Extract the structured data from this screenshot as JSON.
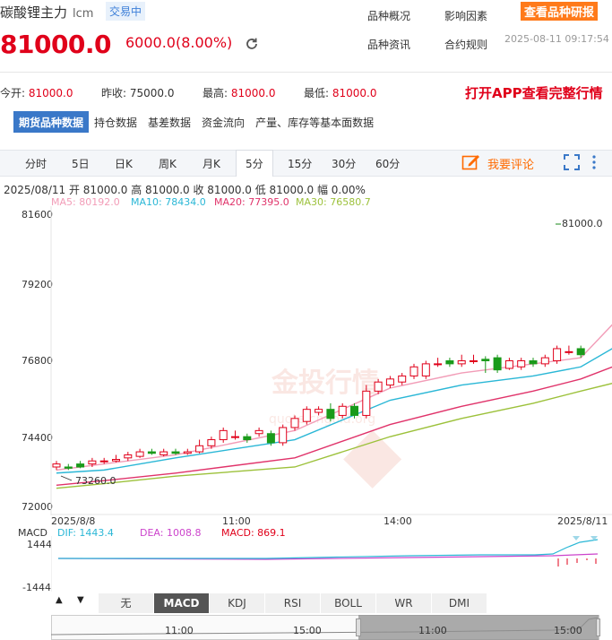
{
  "header": {
    "name": "碳酸锂主力",
    "code": "lcm",
    "status": "交易中",
    "links": [
      "品种概况",
      "影响因素",
      "品种资讯",
      "合约规则"
    ],
    "research_btn": "查看品种研报",
    "price": "81000.0",
    "change": "6000.0(8.00%)",
    "timestamp": "2025-08-11 09:17:54"
  },
  "stats": {
    "open_label": "今开:",
    "open": "81000.0",
    "prev_label": "昨收:",
    "prev": "75000.0",
    "high_label": "最高:",
    "high": "81000.0",
    "low_label": "最低:",
    "low": "81000.0",
    "app_promo": "打开APP查看完整行情"
  },
  "tabs": [
    "期货品种数据",
    "持仓数据",
    "基差数据",
    "资金流向",
    "产量、库存等基本面数据"
  ],
  "periods": [
    "分时",
    "5日",
    "日K",
    "周K",
    "月K",
    "5分",
    "15分",
    "30分",
    "60分"
  ],
  "active_period": "5分",
  "comment_label": "我要评论",
  "ohlc": "2025/08/11  开 81000.0  高 81000.0  收 81000.0  低 81000.0  幅 0.00%",
  "ma": {
    "ma5": "MA5: 80192.0",
    "ma10": "MA10: 78434.0",
    "ma20": "MA20: 77395.0",
    "ma30": "MA30: 76580.7",
    "colors": {
      "ma5": "#f29cb7",
      "ma10": "#2ab7d6",
      "ma20": "#e0336a",
      "ma30": "#9cc13a"
    }
  },
  "y_ticks": [
    "81600",
    "79200",
    "76800",
    "74400",
    "72000"
  ],
  "x_ticks": [
    "2025/8/8",
    "11:00",
    "14:00",
    "2025/8/11"
  ],
  "last_price_label": "81000.0",
  "low_marker": "73260.0",
  "watermark": "金投行情",
  "watermark_url": "quote.cngold.org",
  "macd": {
    "label": "MACD",
    "dif": "DIF: 1443.4",
    "dea": "DEA: 1008.8",
    "macd": "MACD: 869.1",
    "top": "1444",
    "bottom": "-1444",
    "colors": {
      "dif": "#2ab7d6",
      "dea": "#cc44cc",
      "macd": "#e0001a"
    }
  },
  "indicators": [
    "无",
    "MACD",
    "KDJ",
    "RSI",
    "BOLL",
    "WR",
    "DMI"
  ],
  "active_indicator": "MACD",
  "navigator": [
    "11:00",
    "15:00",
    "11:00",
    "15:00"
  ],
  "chart_data": {
    "type": "candlestick",
    "y_range": [
      72000,
      81600
    ],
    "candles": [
      {
        "o": 73300,
        "c": 73400,
        "h": 73500,
        "l": 73200
      },
      {
        "o": 73300,
        "c": 73260,
        "h": 73400,
        "l": 73200
      },
      {
        "o": 73400,
        "c": 73300,
        "h": 73500,
        "l": 73260
      },
      {
        "o": 73400,
        "c": 73500,
        "h": 73600,
        "l": 73300
      },
      {
        "o": 73500,
        "c": 73500,
        "h": 73600,
        "l": 73400
      },
      {
        "o": 73500,
        "c": 73550,
        "h": 73700,
        "l": 73450
      },
      {
        "o": 73600,
        "c": 73700,
        "h": 73800,
        "l": 73500
      },
      {
        "o": 73650,
        "c": 73800,
        "h": 73900,
        "l": 73600
      },
      {
        "o": 73800,
        "c": 73750,
        "h": 73900,
        "l": 73700
      },
      {
        "o": 73700,
        "c": 73800,
        "h": 73900,
        "l": 73650
      },
      {
        "o": 73800,
        "c": 73750,
        "h": 73900,
        "l": 73700
      },
      {
        "o": 73750,
        "c": 73800,
        "h": 73900,
        "l": 73700
      },
      {
        "o": 73800,
        "c": 74000,
        "h": 74200,
        "l": 73750
      },
      {
        "o": 74000,
        "c": 74200,
        "h": 74300,
        "l": 73900
      },
      {
        "o": 74200,
        "c": 74500,
        "h": 74600,
        "l": 74100
      },
      {
        "o": 74300,
        "c": 74300,
        "h": 74500,
        "l": 74200
      },
      {
        "o": 74300,
        "c": 74200,
        "h": 74400,
        "l": 74100
      },
      {
        "o": 74400,
        "c": 74500,
        "h": 74600,
        "l": 74300
      },
      {
        "o": 74400,
        "c": 74100,
        "h": 74500,
        "l": 74000
      },
      {
        "o": 74100,
        "c": 74600,
        "h": 74700,
        "l": 74000
      },
      {
        "o": 74600,
        "c": 74900,
        "h": 75000,
        "l": 74500
      },
      {
        "o": 74800,
        "c": 75200,
        "h": 75300,
        "l": 74700
      },
      {
        "o": 75100,
        "c": 75200,
        "h": 75300,
        "l": 75000
      },
      {
        "o": 75200,
        "c": 74900,
        "h": 75400,
        "l": 74800
      },
      {
        "o": 75000,
        "c": 75300,
        "h": 75400,
        "l": 74900
      },
      {
        "o": 75300,
        "c": 75000,
        "h": 75400,
        "l": 74900
      },
      {
        "o": 75000,
        "c": 75800,
        "h": 76000,
        "l": 74900
      },
      {
        "o": 75800,
        "c": 76100,
        "h": 76200,
        "l": 75700
      },
      {
        "o": 76000,
        "c": 76200,
        "h": 76300,
        "l": 75900
      },
      {
        "o": 76100,
        "c": 76300,
        "h": 76400,
        "l": 76000
      },
      {
        "o": 76300,
        "c": 76600,
        "h": 76700,
        "l": 76200
      },
      {
        "o": 76300,
        "c": 76700,
        "h": 76800,
        "l": 76200
      },
      {
        "o": 76700,
        "c": 76700,
        "h": 76900,
        "l": 76600
      },
      {
        "o": 76800,
        "c": 76700,
        "h": 76900,
        "l": 76600
      },
      {
        "o": 76700,
        "c": 76800,
        "h": 77000,
        "l": 76600
      },
      {
        "o": 76800,
        "c": 76800,
        "h": 77000,
        "l": 76700
      },
      {
        "o": 76850,
        "c": 76800,
        "h": 76950,
        "l": 76400
      },
      {
        "o": 76900,
        "c": 76500,
        "h": 77000,
        "l": 76400
      },
      {
        "o": 76550,
        "c": 76800,
        "h": 76900,
        "l": 76500
      },
      {
        "o": 76600,
        "c": 76800,
        "h": 76900,
        "l": 76500
      },
      {
        "o": 76800,
        "c": 76700,
        "h": 76900,
        "l": 76600
      },
      {
        "o": 76700,
        "c": 76900,
        "h": 77000,
        "l": 76600
      },
      {
        "o": 76800,
        "c": 77200,
        "h": 77300,
        "l": 76700
      },
      {
        "o": 77100,
        "c": 77100,
        "h": 77300,
        "l": 77000
      },
      {
        "o": 77200,
        "c": 77000,
        "h": 77300,
        "l": 76900
      }
    ],
    "last_close": 81000,
    "ma_series": {
      "ma5": [
        [
          0,
          73200
        ],
        [
          4,
          73400
        ],
        [
          10,
          73700
        ],
        [
          20,
          74500
        ],
        [
          28,
          75900
        ],
        [
          34,
          76400
        ],
        [
          40,
          76700
        ],
        [
          44,
          76900
        ],
        [
          52,
          80200
        ]
      ],
      "ma10": [
        [
          0,
          73100
        ],
        [
          4,
          73200
        ],
        [
          10,
          73600
        ],
        [
          20,
          74200
        ],
        [
          28,
          75500
        ],
        [
          34,
          76000
        ],
        [
          40,
          76300
        ],
        [
          44,
          76600
        ],
        [
          52,
          78430
        ]
      ],
      "ma20": [
        [
          0,
          72700
        ],
        [
          4,
          72850
        ],
        [
          10,
          73100
        ],
        [
          20,
          73600
        ],
        [
          28,
          74700
        ],
        [
          34,
          75300
        ],
        [
          40,
          75800
        ],
        [
          44,
          76200
        ],
        [
          52,
          77400
        ]
      ],
      "ma30": [
        [
          0,
          72600
        ],
        [
          4,
          72750
        ],
        [
          10,
          73000
        ],
        [
          20,
          73300
        ],
        [
          28,
          74300
        ],
        [
          34,
          74900
        ],
        [
          40,
          75400
        ],
        [
          44,
          75800
        ],
        [
          52,
          76580
        ]
      ]
    }
  }
}
